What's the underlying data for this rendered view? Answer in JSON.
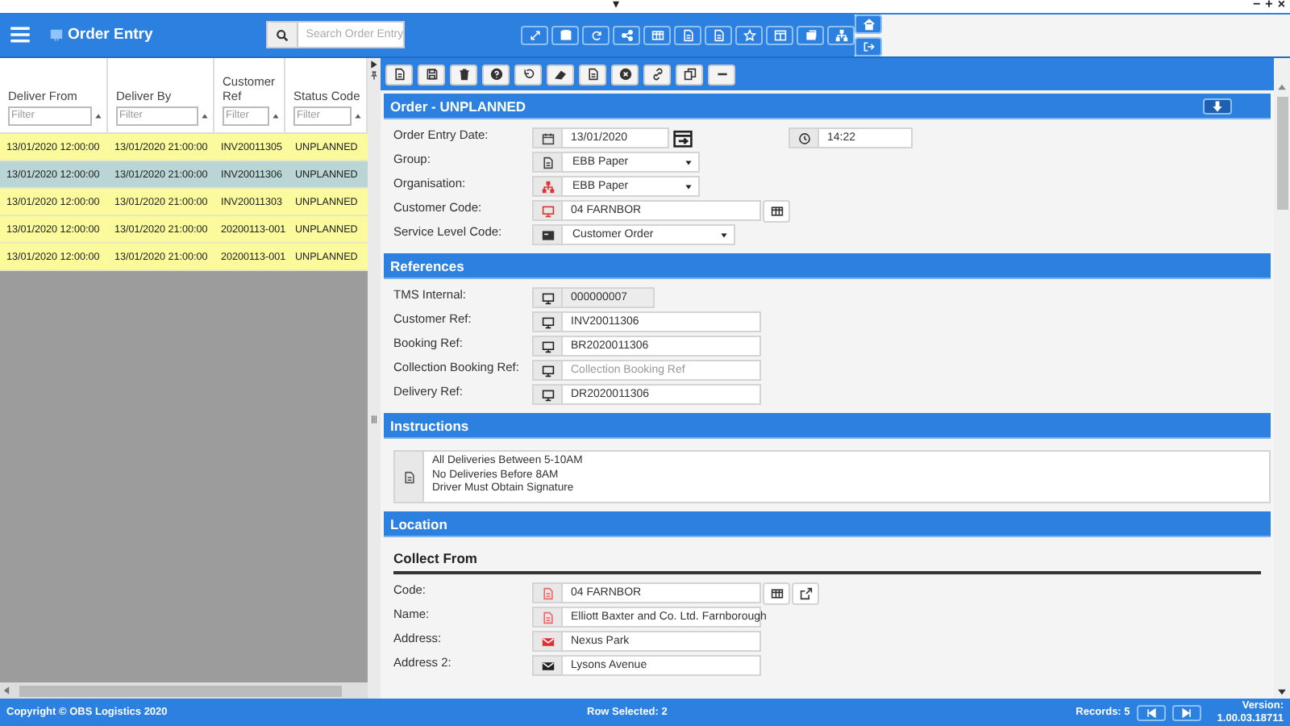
{
  "window_controls": {
    "caret": "▾",
    "minimize": "−",
    "maximize": "+",
    "close": "×"
  },
  "header": {
    "title": "Order Entry",
    "search": {
      "placeholder": "Search Order Entry"
    }
  },
  "grid": {
    "columns": [
      {
        "label": "Deliver From",
        "filter_placeholder": "Filter"
      },
      {
        "label": "Deliver By",
        "filter_placeholder": "Filter"
      },
      {
        "label": "Customer Ref",
        "filter_placeholder": "Filter"
      },
      {
        "label": "Status Code",
        "filter_placeholder": "Filter"
      }
    ],
    "rows": [
      {
        "cells": [
          "13/01/2020 12:00:00",
          "13/01/2020 21:00:00",
          "INV20011305",
          "UNPLANNED"
        ],
        "selected": false
      },
      {
        "cells": [
          "13/01/2020 12:00:00",
          "13/01/2020 21:00:00",
          "INV20011306",
          "UNPLANNED"
        ],
        "selected": true
      },
      {
        "cells": [
          "13/01/2020 12:00:00",
          "13/01/2020 21:00:00",
          "INV20011303",
          "UNPLANNED"
        ],
        "selected": false
      },
      {
        "cells": [
          "13/01/2020 12:00:00",
          "13/01/2020 21:00:00",
          "20200113-001",
          "UNPLANNED"
        ],
        "selected": false
      },
      {
        "cells": [
          "13/01/2020 12:00:00",
          "13/01/2020 21:00:00",
          "20200113-001",
          "UNPLANNED"
        ],
        "selected": false
      }
    ]
  },
  "order": {
    "title": "Order - UNPLANNED",
    "fields": [
      {
        "label": "Order Entry Date:",
        "kind": "date",
        "value": "13/01/2020",
        "time": "14:22"
      },
      {
        "label": "Group:",
        "kind": "select",
        "value": "EBB Paper"
      },
      {
        "label": "Organisation:",
        "kind": "select",
        "value": "EBB Paper"
      },
      {
        "label": "Customer Code:",
        "kind": "lookup",
        "value": "04 FARNBOR"
      },
      {
        "label": "Service Level Code:",
        "kind": "select",
        "value": "Customer Order"
      }
    ]
  },
  "references": {
    "title": "References",
    "fields": [
      {
        "label": "TMS Internal:",
        "kind": "readonly",
        "value": "000000007"
      },
      {
        "label": "Customer Ref:",
        "kind": "text",
        "value": "INV20011306"
      },
      {
        "label": "Booking Ref:",
        "kind": "text",
        "value": "BR2020011306"
      },
      {
        "label": "Collection Booking Ref:",
        "kind": "text",
        "placeholder": "Collection Booking Ref"
      },
      {
        "label": "Delivery Ref:",
        "kind": "text",
        "value": "DR2020011306"
      }
    ]
  },
  "instructions": {
    "title": "Instructions",
    "value": "All Deliveries Between 5-10AM\nNo Deliveries Before 8AM\nDriver Must Obtain Signature"
  },
  "location": {
    "title": "Location",
    "subtitle": "Collect From",
    "fields": [
      {
        "label": "Code:",
        "kind": "lookup_link",
        "value": "04 FARNBOR"
      },
      {
        "label": "Name:",
        "kind": "text",
        "value": "Elliott Baxter and Co. Ltd. Farnborough"
      },
      {
        "label": "Address:",
        "kind": "text",
        "value": "Nexus Park"
      },
      {
        "label": "Address 2:",
        "kind": "text",
        "value": "Lysons Avenue"
      }
    ]
  },
  "status_bar": {
    "copyright": "Copyright © OBS Logistics 2020",
    "row_selected": "Row Selected: 2",
    "records": "Records: 5",
    "version_label": "Version:",
    "version": "1.00.03.18711"
  }
}
